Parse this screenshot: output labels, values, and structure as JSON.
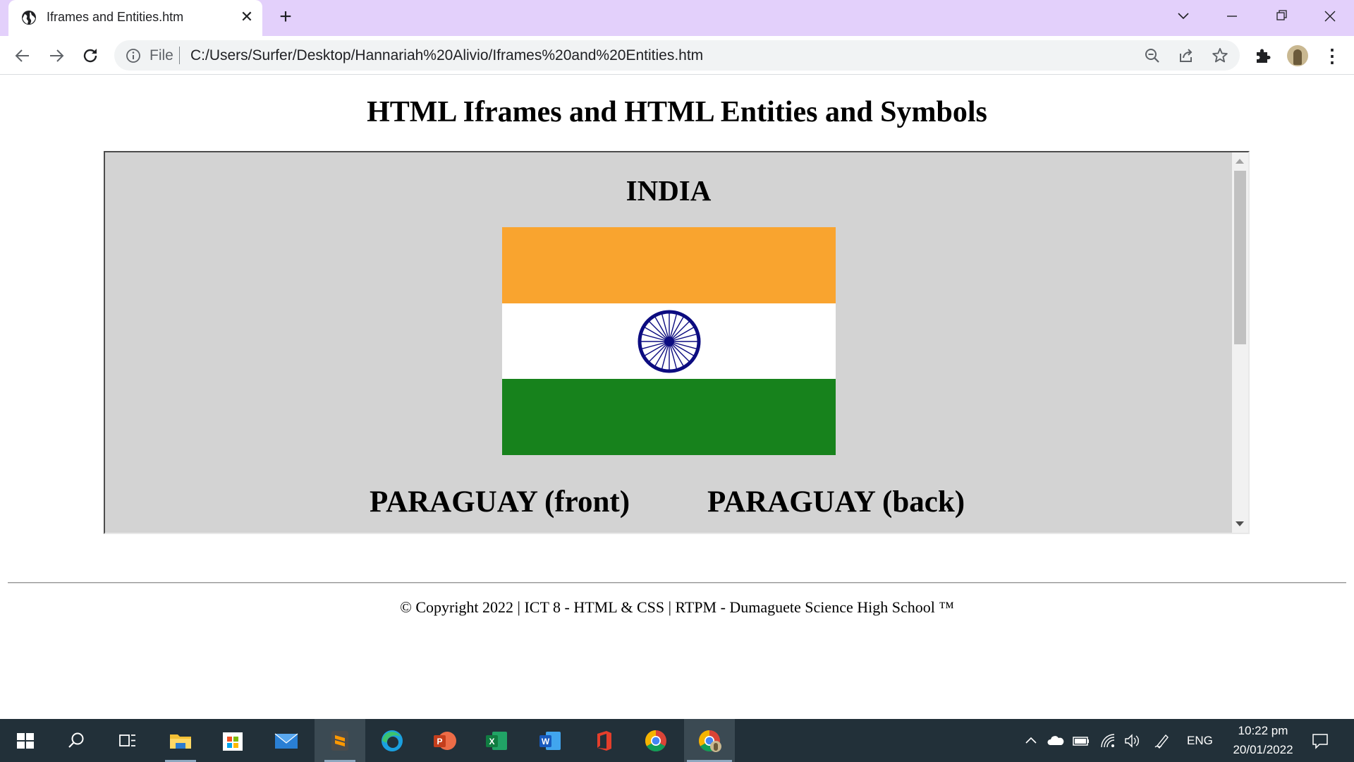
{
  "browser": {
    "tab_title": "Iframes and Entities.htm",
    "omnibox_scheme": "File",
    "url": "C:/Users/Surfer/Desktop/Hannariah%20Alivio/Iframes%20and%20Entities.htm"
  },
  "page": {
    "title": "HTML Iframes and HTML Entities and Symbols",
    "footer": "© Copyright 2022 | ICT 8 - HTML & CSS | RTPM - Dumaguete Science High School ™"
  },
  "iframe": {
    "heading_india": "INDIA",
    "heading_paraguay_front": "PARAGUAY (front)",
    "heading_paraguay_back": "PARAGUAY (back)",
    "flag_colors": {
      "saffron": "#f9a42f",
      "white": "#ffffff",
      "green": "#17821c",
      "chakra": "#0c0c80"
    },
    "background": "#d3d3d3"
  },
  "taskbar": {
    "apps": [
      "windows-start",
      "search",
      "task-view",
      "file-explorer",
      "microsoft-store",
      "mail",
      "sublime-text",
      "edge",
      "powerpoint",
      "excel",
      "word",
      "office",
      "chrome",
      "chrome-profile"
    ],
    "language": "ENG",
    "time": "10:22 pm",
    "date": "20/01/2022"
  }
}
